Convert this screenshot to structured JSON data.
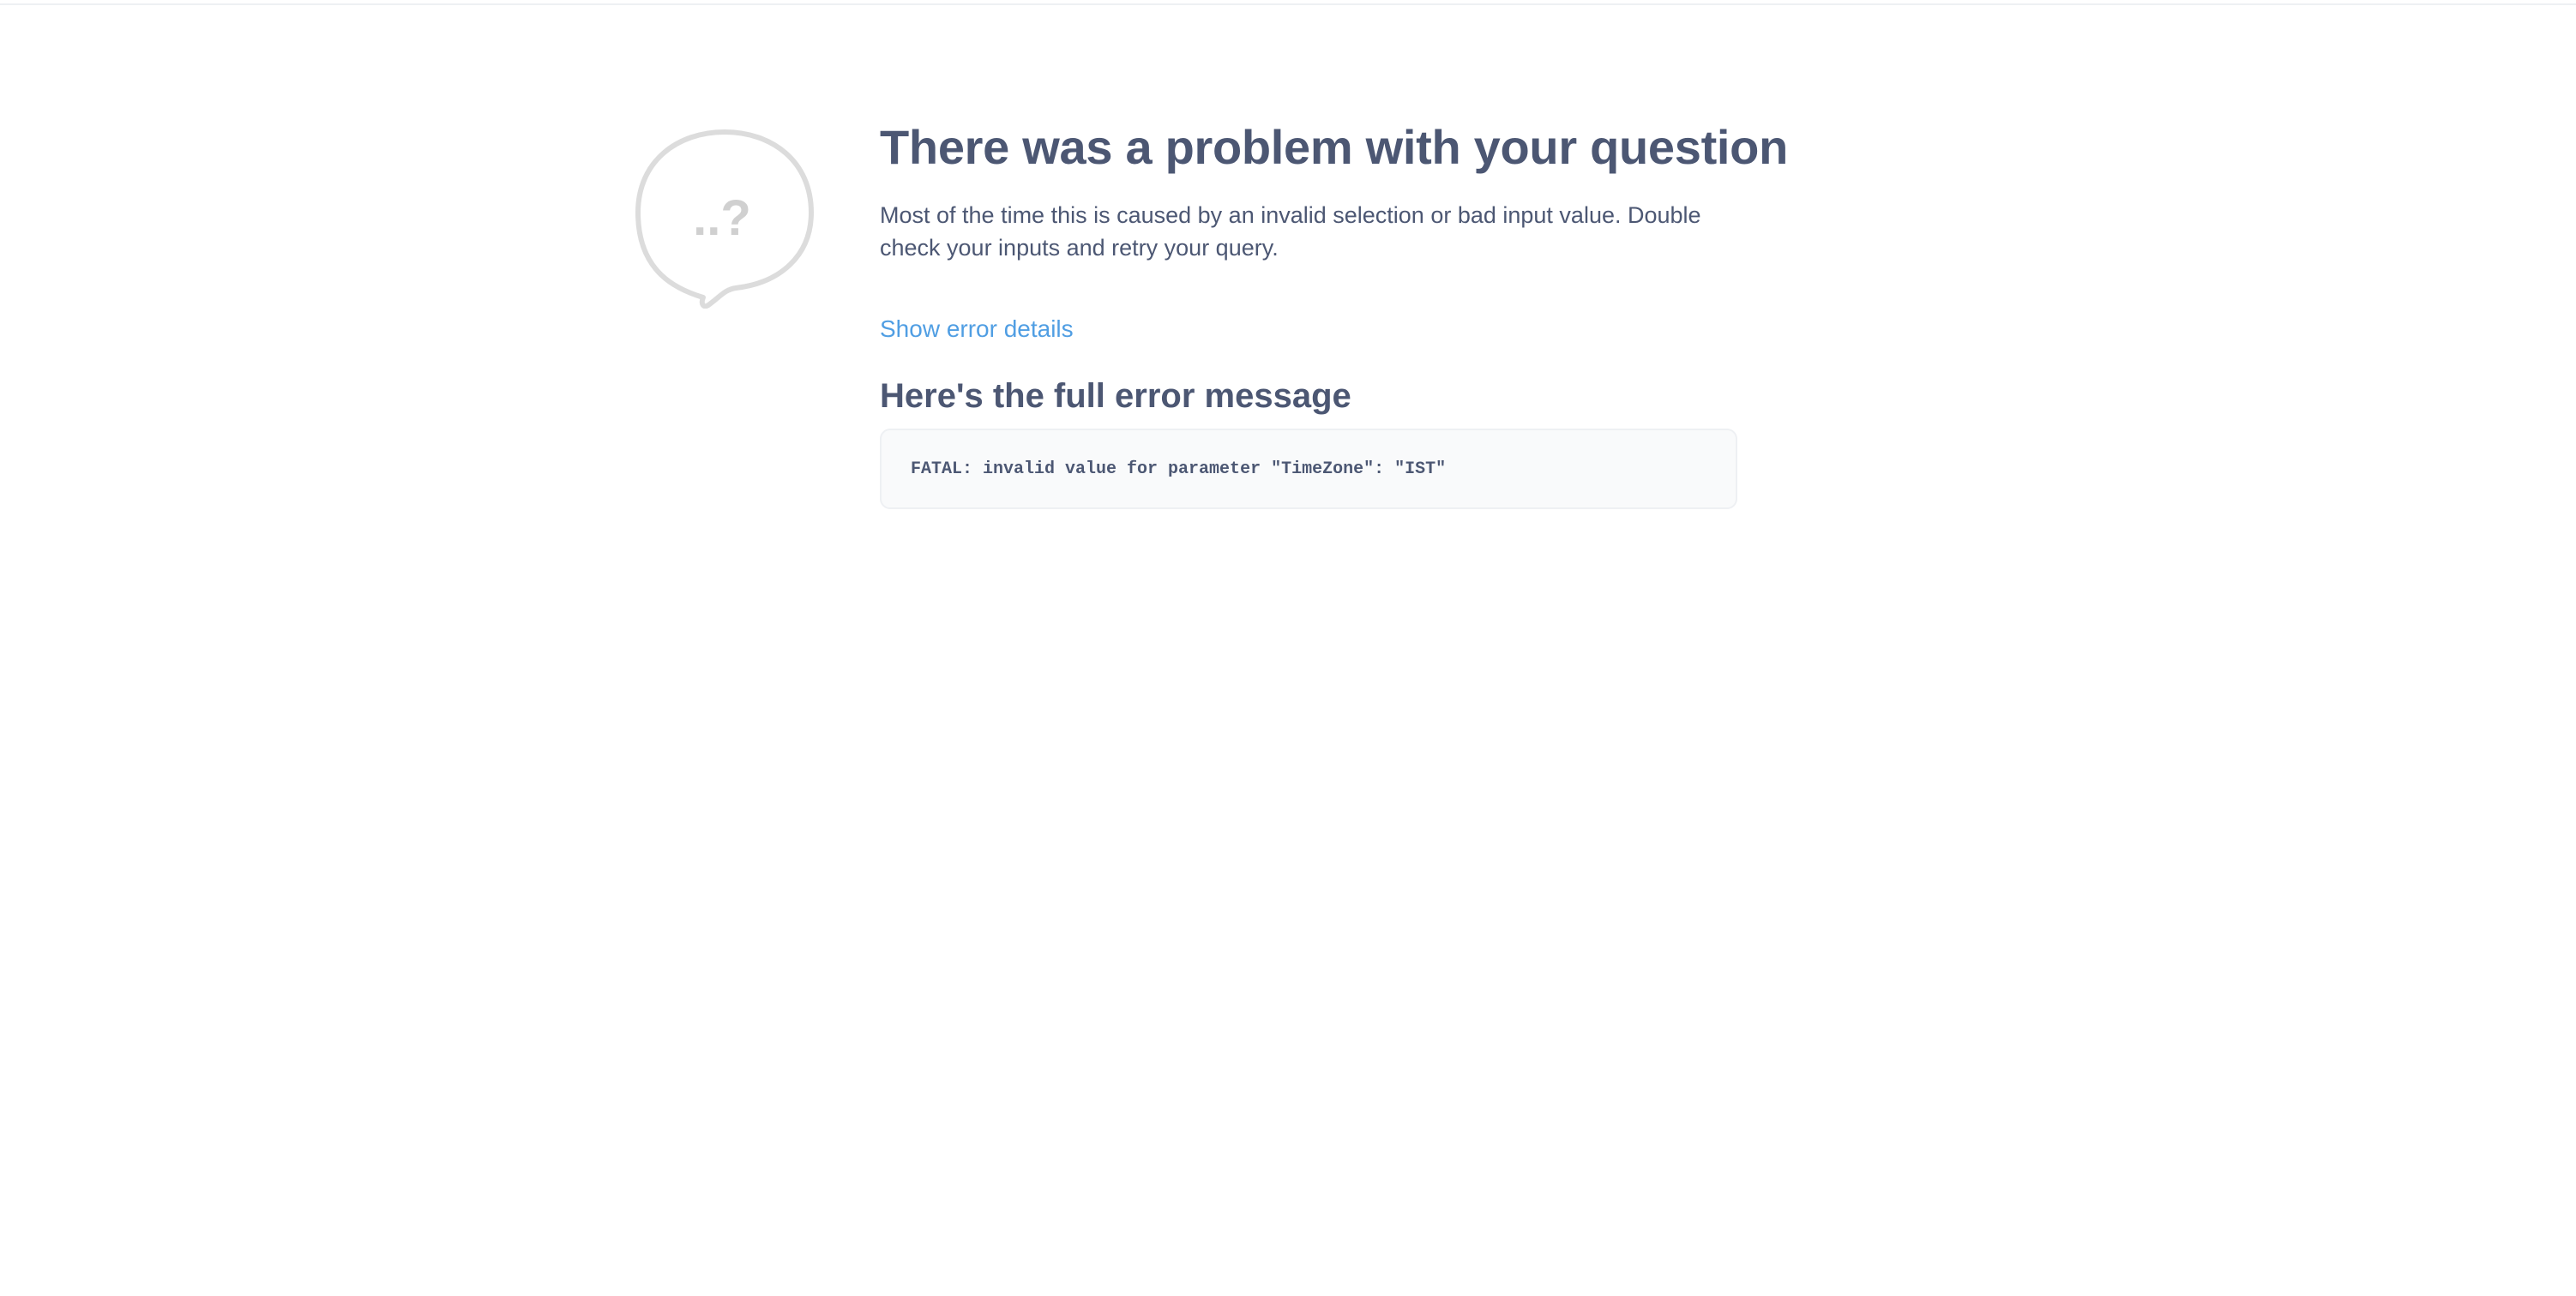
{
  "error": {
    "title": "There was a problem with your question",
    "description": "Most of the time this is caused by an invalid selection or bad input value. Double check your inputs and retry your query.",
    "details_link": "Show error details",
    "full_message_heading": "Here's the full error message",
    "message": "FATAL: invalid value for parameter \"TimeZone\": \"IST\""
  },
  "illustration": {
    "icon": "speech-bubble-question-icon",
    "glyph": "..?"
  },
  "colors": {
    "text": "#4c5773",
    "link": "#509ee3",
    "illustration": "#dcdcdc",
    "box_background": "#f9fafb",
    "box_border": "#eef0f3"
  }
}
